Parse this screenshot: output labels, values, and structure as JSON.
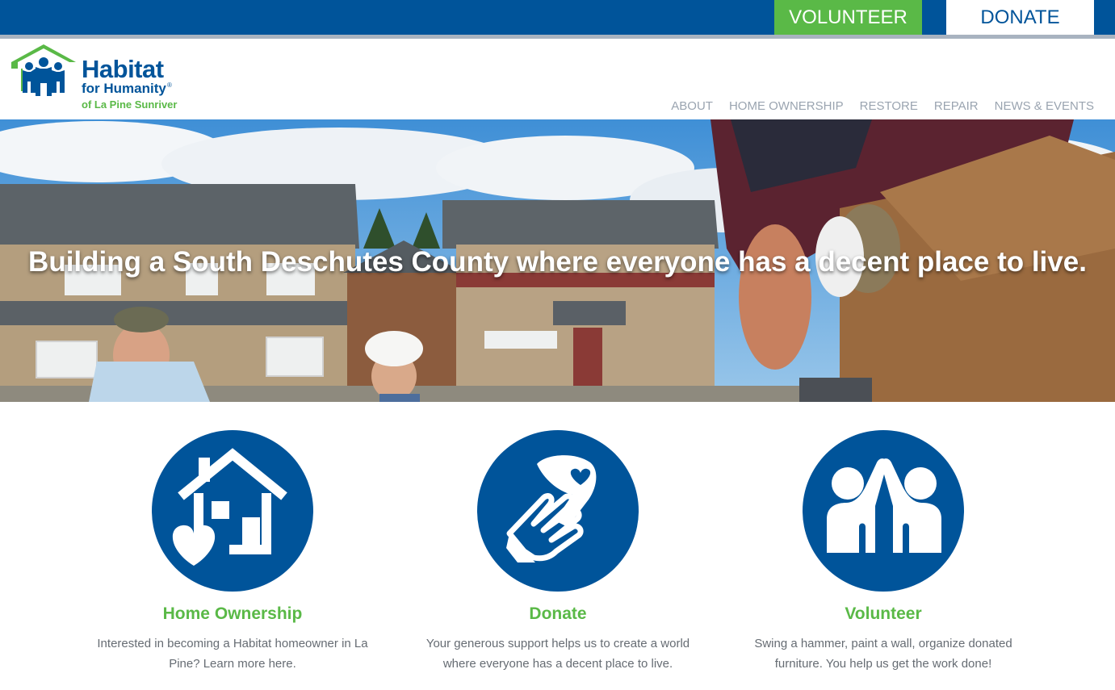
{
  "topbar": {
    "volunteer_label": "VOLUNTEER",
    "donate_label": "DONATE"
  },
  "logo": {
    "line1": "Habitat",
    "line2": "for Humanity",
    "line3": "of La Pine Sunriver",
    "reg": "®"
  },
  "nav": {
    "items": [
      "ABOUT",
      "HOME OWNERSHIP",
      "RESTORE",
      "REPAIR",
      "NEWS & EVENTS"
    ]
  },
  "hero": {
    "headline": "Building a South Deschutes County where everyone has a decent place to live."
  },
  "features": [
    {
      "icon": "house-heart-icon",
      "title": "Home Ownership",
      "description": "Interested in becoming a Habitat homeowner in La Pine? Learn more here."
    },
    {
      "icon": "hand-heart-icon",
      "title": "Donate",
      "description": "Your generous support helps us to create a world where everyone has a decent place to live."
    },
    {
      "icon": "high-five-icon",
      "title": "Volunteer",
      "description": "Swing a hammer, paint a wall, organize donated furniture. You help us get the work done!"
    }
  ],
  "colors": {
    "brand_blue": "#00549a",
    "brand_green": "#5ab947",
    "nav_gray": "#9aa4b0",
    "text_gray": "#666c73"
  }
}
